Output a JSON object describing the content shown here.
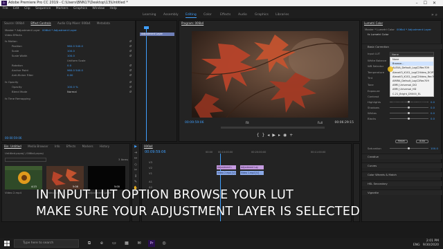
{
  "window": {
    "app_icon": "Pr",
    "title": "Adobe Premiere Pro CC 2019 - C:\\Users\\BNN17\\Desktop\\13\\Untitled *"
  },
  "menu": [
    "File",
    "Edit",
    "Clip",
    "Sequence",
    "Markers",
    "Graphics",
    "Window",
    "Help"
  ],
  "workspaces": [
    "Learning",
    "Assembly",
    "Editing",
    "Color",
    "Effects",
    "Audio",
    "Graphics",
    "Libraries"
  ],
  "workspace_active": "Editing",
  "source_panel": {
    "tabs": [
      "Source: 006b4",
      "Effect Controls",
      "Audio Clip Mixer: 006b4",
      "Metadata"
    ],
    "active_tab": "Effect Controls",
    "clip_label": "Master * Adjustment Layer",
    "seq_label": "006b4 * Adjustment Layer",
    "clip_bar": "Adjustment Layer",
    "section": "Video Effects",
    "rows": [
      {
        "label": "fx  Motion",
        "value": ""
      },
      {
        "label": "Position",
        "value": "960.0   540.0"
      },
      {
        "label": "Scale",
        "value": "100.0"
      },
      {
        "label": "Scale Width",
        "value": "100.0"
      },
      {
        "label": "",
        "value": "Uniform Scale"
      },
      {
        "label": "Rotation",
        "value": "0.0"
      },
      {
        "label": "Anchor Point",
        "value": "960.0   540.0"
      },
      {
        "label": "Anti-flicker Filter",
        "value": "0.00"
      },
      {
        "label": "fx  Opacity",
        "value": ""
      },
      {
        "label": "Opacity",
        "value": "100.0 %"
      },
      {
        "label": "Blend Mode",
        "value": "Normal"
      },
      {
        "label": "fx  Time Remapping",
        "value": ""
      }
    ],
    "timecode": "00:00:59:06"
  },
  "program_monitor": {
    "title": "Program: 006b4",
    "time_current": "00:09:59:06",
    "fit": "Fit",
    "quality": "Full",
    "time_total": "00:06:29:15"
  },
  "lumetri": {
    "title": "Lumetri Color",
    "clip_label": "Master * Lumetri Color",
    "seq_label": "006b4 * Adjustment Layer",
    "fx_label": "fx  Lumetri Color",
    "basic_correction": "Basic Correction",
    "input_lut_label": "Input LUT",
    "input_lut_value": "None",
    "white_balance_label": "White Balance",
    "wb_selector_label": "WB Selector",
    "temperature_label": "Temperature",
    "tint_label": "Tint",
    "tone_label": "Tone",
    "exposure_label": "Exposure",
    "contrast_label": "Contrast",
    "highlights_label": "Highlights",
    "shadows_label": "Shadows",
    "whites_label": "Whites",
    "blacks_label": "Blacks",
    "reset_label": "Reset",
    "auto_label": "Auto",
    "saturation_label": "Saturation",
    "saturation_value": "100.0",
    "lut_options": [
      "None",
      "Browse...",
      "ALEXA_Default_LogC2Rec709",
      "AlexaV3_K1S1_LogC2Video_DCIP3_EE",
      "AlexaV3_K1S1_LogC2Video_Rec709_EE",
      "AMIRA_Default_LogC2Rec709",
      "ARRI_Universal_DCI",
      "ARRI_Universal_HD",
      "C-21_Bright_D5000_EL",
      "Panasonic_V-Log_to_V709_forV35_ver100",
      "Rec709_to_Log_PQ_Gamma"
    ],
    "lut_highlighted": "Browse...",
    "sections": [
      "Creative",
      "Curves",
      "Color Wheels & Match",
      "HSL Secondary",
      "Vignette"
    ],
    "slider_values": [
      "0.0",
      "0.0",
      "0.0",
      "0.0",
      "0.0",
      "0.0",
      "0.0",
      "0.0"
    ]
  },
  "project_panel": {
    "tabs": [
      "Bin: Untitled",
      "Media Browser",
      "Info",
      "Effects",
      "Markers",
      "History"
    ],
    "active_tab": "Bin: Untitled",
    "project_label": "Untitled.prproj \\ 006b4.prproj",
    "items_count": "3 Items",
    "clips": [
      {
        "name": "Video 2.mp4",
        "duration": "4:23"
      },
      {
        "name": "Video 1.mp4",
        "duration": "5:08"
      },
      {
        "name": "Adjustment Layer",
        "duration": "5:00"
      }
    ]
  },
  "tools": [
    "▶",
    "⇥",
    "↔",
    "◇",
    "✂",
    "↕",
    "✎",
    "✋",
    "T"
  ],
  "timeline": {
    "tab_label": "006b4",
    "timecode": "00:09:59:06",
    "ruler": [
      "00:00",
      "00:10:00:00",
      "00:20:00:00",
      "00:11:00:00"
    ],
    "tracks": [
      "V3",
      "V2",
      "V1",
      "A1",
      "A2",
      "A3"
    ],
    "clips_fx": [
      {
        "label": "Adjustment L",
        "track": "V2"
      },
      {
        "label": "Adjustment Lay",
        "track": "V2"
      }
    ],
    "clips_video": [
      {
        "label": "Video 2.mp4 [V]",
        "track": "V1"
      },
      {
        "label": "Video 1.mp4 [V]",
        "track": "V1"
      }
    ]
  },
  "caption": {
    "line1": "IN INPUT LUT OPTION BROWSE YOUR LUT",
    "line2": "MAKE SURE YOUR ADJUSTMENT LAYER IS SELECTED"
  },
  "taskbar": {
    "search_placeholder": "Type here to search",
    "time": "2:01 PM",
    "date": "9/30/2020",
    "lang": "ENG"
  },
  "colors": {
    "accent": "#3fa0ff",
    "fx_clip": "#c59be0",
    "video_clip": "#8aa8e6"
  }
}
